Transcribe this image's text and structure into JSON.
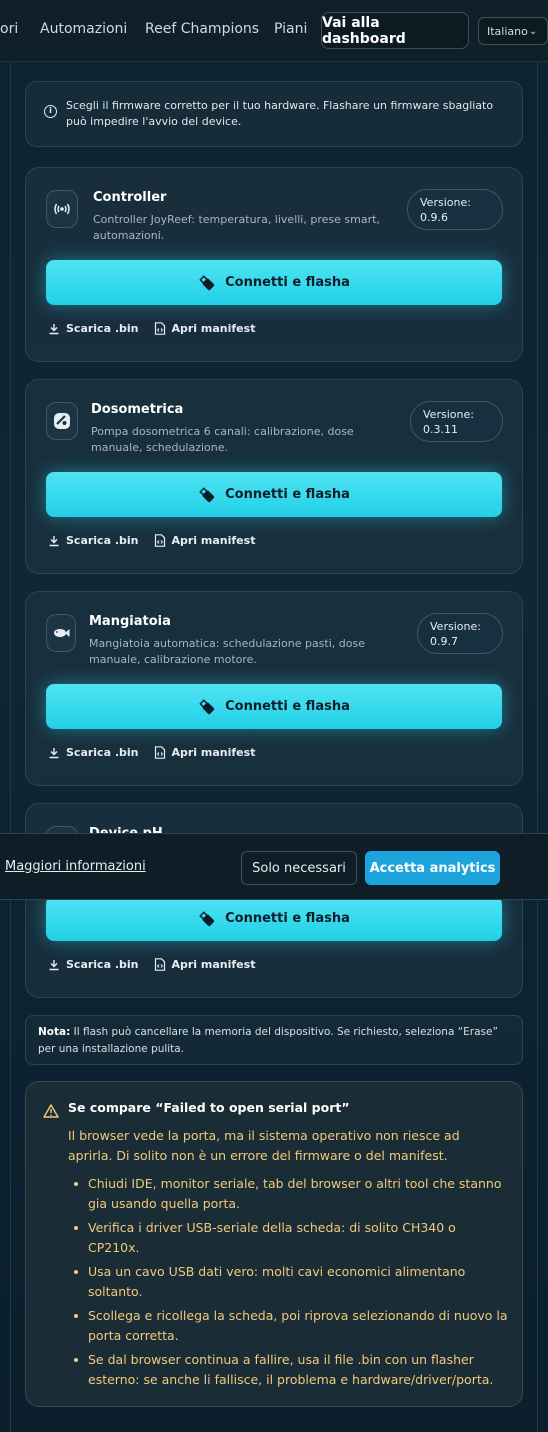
{
  "nav": {
    "links": [
      "ori",
      "Automazioni",
      "Reef Champions",
      "Piani"
    ],
    "dashboard_button": "Vai alla dashboard",
    "language": "Italiano"
  },
  "info": {
    "text": "Scegli il firmware corretto per il tuo hardware. Flashare un firmware sbagliato può impedire l'avvio del device."
  },
  "cards": [
    {
      "name": "Controller",
      "description": "Controller JoyReef: temperatura, livelli, prese smart, automazioni.",
      "version_label": "Versione:",
      "version": "0.9.6",
      "icon": "radio-signal-icon"
    },
    {
      "name": "Dosometrica",
      "description": "Pompa dosometrica 6 canali: calibrazione, dose manuale, schedulazione.",
      "version_label": "Versione:",
      "version": "0.3.11",
      "icon": "pump-icon"
    },
    {
      "name": "Mangiatoia",
      "description": "Mangiatoia automatica: schedulazione pasti, dose manuale, calibrazione motore.",
      "version_label": "Versione:",
      "version": "0.9.7",
      "icon": "fish-icon"
    },
    {
      "name": "Device pH",
      "description": "",
      "version_label": "",
      "version": "",
      "icon": "ph-icon"
    }
  ],
  "actions": {
    "flash_label": "Connetti e flasha",
    "download_label": "Scarica .bin",
    "manifest_label": "Apri manifest"
  },
  "cookie": {
    "more_info": "Maggiori informazioni",
    "necessary": "Solo necessari",
    "accept": "Accetta analytics"
  },
  "note": {
    "bold": "Nota:",
    "text": " Il flash può cancellare la memoria del dispositivo. Se richiesto, seleziona “Erase” per una installazione pulita."
  },
  "warning": {
    "title": "Se compare “Failed to open serial port”",
    "intro": "Il browser vede la porta, ma il sistema operativo non riesce ad aprirla. Di solito non è un errore del firmware o del manifest.",
    "items": [
      "Chiudi IDE, monitor seriale, tab del browser o altri tool che stanno gia usando quella porta.",
      "Verifica i driver USB-seriale della scheda: di solito CH340 o CP210x.",
      "Usa un cavo USB dati vero: molti cavi economici alimentano soltanto.",
      "Scollega e ricollega la scheda, poi riprova selezionando di nuovo la porta corretta.",
      "Se dal browser continua a fallire, usa il file .bin con un flasher esterno: se anche li fallisce, il problema e hardware/driver/porta."
    ]
  },
  "colors": {
    "accent": "#22d0e6",
    "accept_button": "#1da4dd",
    "warning_text": "#f0c97a",
    "background": "#0f2836"
  }
}
